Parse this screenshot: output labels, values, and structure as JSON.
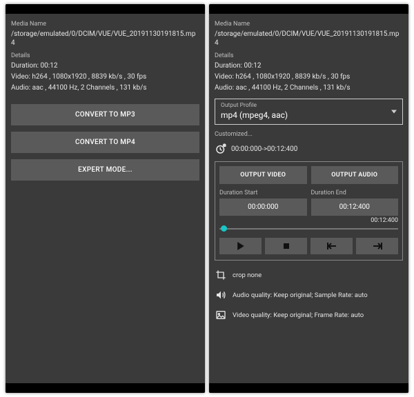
{
  "left": {
    "mediaNameLabel": "Media Name",
    "mediaPath": "/storage/emulated/0/DCIM/VUE/VUE_20191130191815.mp4",
    "detailsLabel": "Details",
    "duration": "Duration: 00:12",
    "video": "Video: h264 , 1080x1920 , 8839 kb/s , 30 fps",
    "audio": "Audio: aac , 44100 Hz, 2 Channels , 131 kb/s",
    "btn_mp3": "CONVERT TO MP3",
    "btn_mp4": "CONVERT TO MP4",
    "btn_expert": "EXPERT MODE..."
  },
  "right": {
    "mediaNameLabel": "Media Name",
    "mediaPath": "/storage/emulated/0/DCIM/VUE/VUE_20191130191815.mp4",
    "detailsLabel": "Details",
    "duration": "Duration: 00:12",
    "video": "Video: h264 , 1080x1920 , 8839 kb/s , 30 fps",
    "audio": "Audio: aac , 44100 Hz, 2 Channels , 131 kb/s",
    "outputProfileLabel": "Output Profile",
    "outputProfileValue": "mp4 (mpeg4, aac)",
    "customized": "Customized...",
    "timeRange": "00:00:000->00:12:400",
    "tab_video": "OUTPUT VIDEO",
    "tab_audio": "OUTPUT AUDIO",
    "dur_start_label": "Duration Start",
    "dur_start_value": "00:00:000",
    "dur_end_label": "Duration End",
    "dur_end_value": "00:12:400",
    "slider_max": "00:12:400",
    "crop": "crop none",
    "audio_quality": "Audio quality: Keep original; Sample Rate: auto",
    "video_quality": "Video quality: Keep original; Frame Rate: auto"
  }
}
